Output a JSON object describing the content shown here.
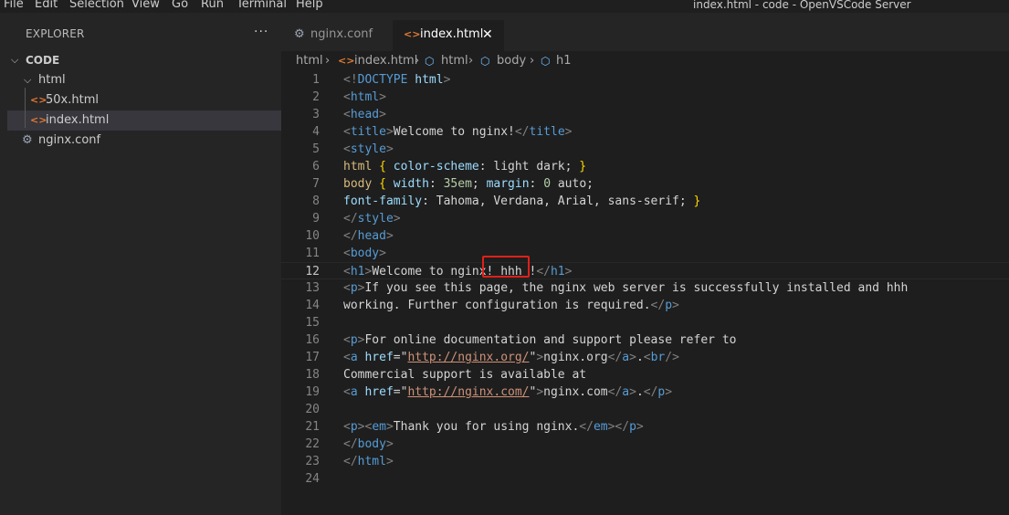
{
  "menubar": {
    "items": [
      "File",
      "Edit",
      "Selection",
      "View",
      "Go",
      "Run",
      "Terminal",
      "Help"
    ],
    "window_title": "index.html - code - OpenVSCode Server"
  },
  "sidebar": {
    "title": "EXPLORER",
    "more": "···",
    "root": "CODE",
    "folder": "html",
    "files": [
      "50x.html",
      "index.html"
    ],
    "root_file": "nginx.conf"
  },
  "tabs": [
    {
      "label": "nginx.conf",
      "icon": "gear-icon",
      "active": false
    },
    {
      "label": "index.html",
      "icon": "html-code-icon",
      "active": true
    }
  ],
  "breadcrumb": [
    "html",
    "index.html",
    "html",
    "body",
    "h1"
  ],
  "editor": {
    "current_line": 12,
    "line_numbers": [
      "1",
      "2",
      "3",
      "4",
      "5",
      "6",
      "7",
      "8",
      "9",
      "10",
      "11",
      "12",
      "13",
      "14",
      "15",
      "16",
      "17",
      "18",
      "19",
      "20",
      "21",
      "22",
      "23",
      "24"
    ],
    "lines": [
      [
        [
          "t-tag",
          "<!"
        ],
        [
          "t-name",
          "DOCTYPE"
        ],
        [
          "t-plain",
          " "
        ],
        [
          "t-prop",
          "html"
        ],
        [
          "t-tag",
          ">"
        ]
      ],
      [
        [
          "t-tag",
          "<"
        ],
        [
          "t-name",
          "html"
        ],
        [
          "t-tag",
          ">"
        ]
      ],
      [
        [
          "t-tag",
          "<"
        ],
        [
          "t-name",
          "head"
        ],
        [
          "t-tag",
          ">"
        ]
      ],
      [
        [
          "t-tag",
          "<"
        ],
        [
          "t-name",
          "title"
        ],
        [
          "t-tag",
          ">"
        ],
        [
          "t-text",
          "Welcome to nginx!"
        ],
        [
          "t-tag",
          "</"
        ],
        [
          "t-name",
          "title"
        ],
        [
          "t-tag",
          ">"
        ]
      ],
      [
        [
          "t-tag",
          "<"
        ],
        [
          "t-name",
          "style"
        ],
        [
          "t-tag",
          ">"
        ]
      ],
      [
        [
          "t-sel",
          "html"
        ],
        [
          "t-plain",
          " "
        ],
        [
          "t-brace",
          "{"
        ],
        [
          "t-plain",
          " "
        ],
        [
          "t-prop",
          "color-scheme"
        ],
        [
          "t-plain",
          ": light dark; "
        ],
        [
          "t-brace",
          "}"
        ]
      ],
      [
        [
          "t-sel",
          "body"
        ],
        [
          "t-plain",
          " "
        ],
        [
          "t-brace",
          "{"
        ],
        [
          "t-plain",
          " "
        ],
        [
          "t-prop",
          "width"
        ],
        [
          "t-plain",
          ": "
        ],
        [
          "t-num",
          "35em"
        ],
        [
          "t-plain",
          "; "
        ],
        [
          "t-prop",
          "margin"
        ],
        [
          "t-plain",
          ": "
        ],
        [
          "t-num",
          "0"
        ],
        [
          "t-plain",
          " auto;"
        ]
      ],
      [
        [
          "t-prop",
          "font-family"
        ],
        [
          "t-plain",
          ": Tahoma, Verdana, Arial, sans-serif; "
        ],
        [
          "t-brace",
          "}"
        ]
      ],
      [
        [
          "t-tag",
          "</"
        ],
        [
          "t-name",
          "style"
        ],
        [
          "t-tag",
          ">"
        ]
      ],
      [
        [
          "t-tag",
          "</"
        ],
        [
          "t-name",
          "head"
        ],
        [
          "t-tag",
          ">"
        ]
      ],
      [
        [
          "t-tag",
          "<"
        ],
        [
          "t-name",
          "body"
        ],
        [
          "t-tag",
          ">"
        ]
      ],
      [
        [
          "t-tag",
          "<"
        ],
        [
          "t-name",
          "h1"
        ],
        [
          "t-tag",
          ">"
        ],
        [
          "t-text",
          "Welcome to nginx! hhh !"
        ],
        [
          "t-tag",
          "</"
        ],
        [
          "t-name",
          "h1"
        ],
        [
          "t-tag",
          ">"
        ]
      ],
      [
        [
          "t-tag",
          "<"
        ],
        [
          "t-name",
          "p"
        ],
        [
          "t-tag",
          ">"
        ],
        [
          "t-text",
          "If you see this page, the nginx web server is successfully installed and hhh"
        ]
      ],
      [
        [
          "t-text",
          "working. Further configuration is required."
        ],
        [
          "t-tag",
          "</"
        ],
        [
          "t-name",
          "p"
        ],
        [
          "t-tag",
          ">"
        ]
      ],
      [],
      [
        [
          "t-tag",
          "<"
        ],
        [
          "t-name",
          "p"
        ],
        [
          "t-tag",
          ">"
        ],
        [
          "t-text",
          "For online documentation and support please refer to"
        ]
      ],
      [
        [
          "t-tag",
          "<"
        ],
        [
          "t-name",
          "a"
        ],
        [
          "t-plain",
          " "
        ],
        [
          "t-attr",
          "href"
        ],
        [
          "t-plain",
          "=\""
        ],
        [
          "t-str",
          "http://nginx.org/"
        ],
        [
          "t-plain",
          "\""
        ],
        [
          "t-tag",
          ">"
        ],
        [
          "t-text",
          "nginx.org"
        ],
        [
          "t-tag",
          "</"
        ],
        [
          "t-name",
          "a"
        ],
        [
          "t-tag",
          ">"
        ],
        [
          "t-text",
          "."
        ],
        [
          "t-tag",
          "<"
        ],
        [
          "t-name",
          "br"
        ],
        [
          "t-tag",
          "/>"
        ]
      ],
      [
        [
          "t-text",
          "Commercial support is available at"
        ]
      ],
      [
        [
          "t-tag",
          "<"
        ],
        [
          "t-name",
          "a"
        ],
        [
          "t-plain",
          " "
        ],
        [
          "t-attr",
          "href"
        ],
        [
          "t-plain",
          "=\""
        ],
        [
          "t-str",
          "http://nginx.com/"
        ],
        [
          "t-plain",
          "\""
        ],
        [
          "t-tag",
          ">"
        ],
        [
          "t-text",
          "nginx.com"
        ],
        [
          "t-tag",
          "</"
        ],
        [
          "t-name",
          "a"
        ],
        [
          "t-tag",
          ">"
        ],
        [
          "t-text",
          "."
        ],
        [
          "t-tag",
          "</"
        ],
        [
          "t-name",
          "p"
        ],
        [
          "t-tag",
          ">"
        ]
      ],
      [],
      [
        [
          "t-tag",
          "<"
        ],
        [
          "t-name",
          "p"
        ],
        [
          "t-tag",
          "><"
        ],
        [
          "t-name",
          "em"
        ],
        [
          "t-tag",
          ">"
        ],
        [
          "t-text",
          "Thank you for using nginx."
        ],
        [
          "t-tag",
          "</"
        ],
        [
          "t-name",
          "em"
        ],
        [
          "t-tag",
          "></"
        ],
        [
          "t-name",
          "p"
        ],
        [
          "t-tag",
          ">"
        ]
      ],
      [
        [
          "t-tag",
          "</"
        ],
        [
          "t-name",
          "body"
        ],
        [
          "t-tag",
          ">"
        ]
      ],
      [
        [
          "t-tag",
          "</"
        ],
        [
          "t-name",
          "html"
        ],
        [
          "t-tag",
          ">"
        ]
      ],
      []
    ]
  },
  "colors": {
    "editor_bg": "#1e1e1e",
    "sidebar_bg": "#252526",
    "tag_name": "#569cd6",
    "string": "#ce9178",
    "highlight_box": "#e0201a"
  }
}
